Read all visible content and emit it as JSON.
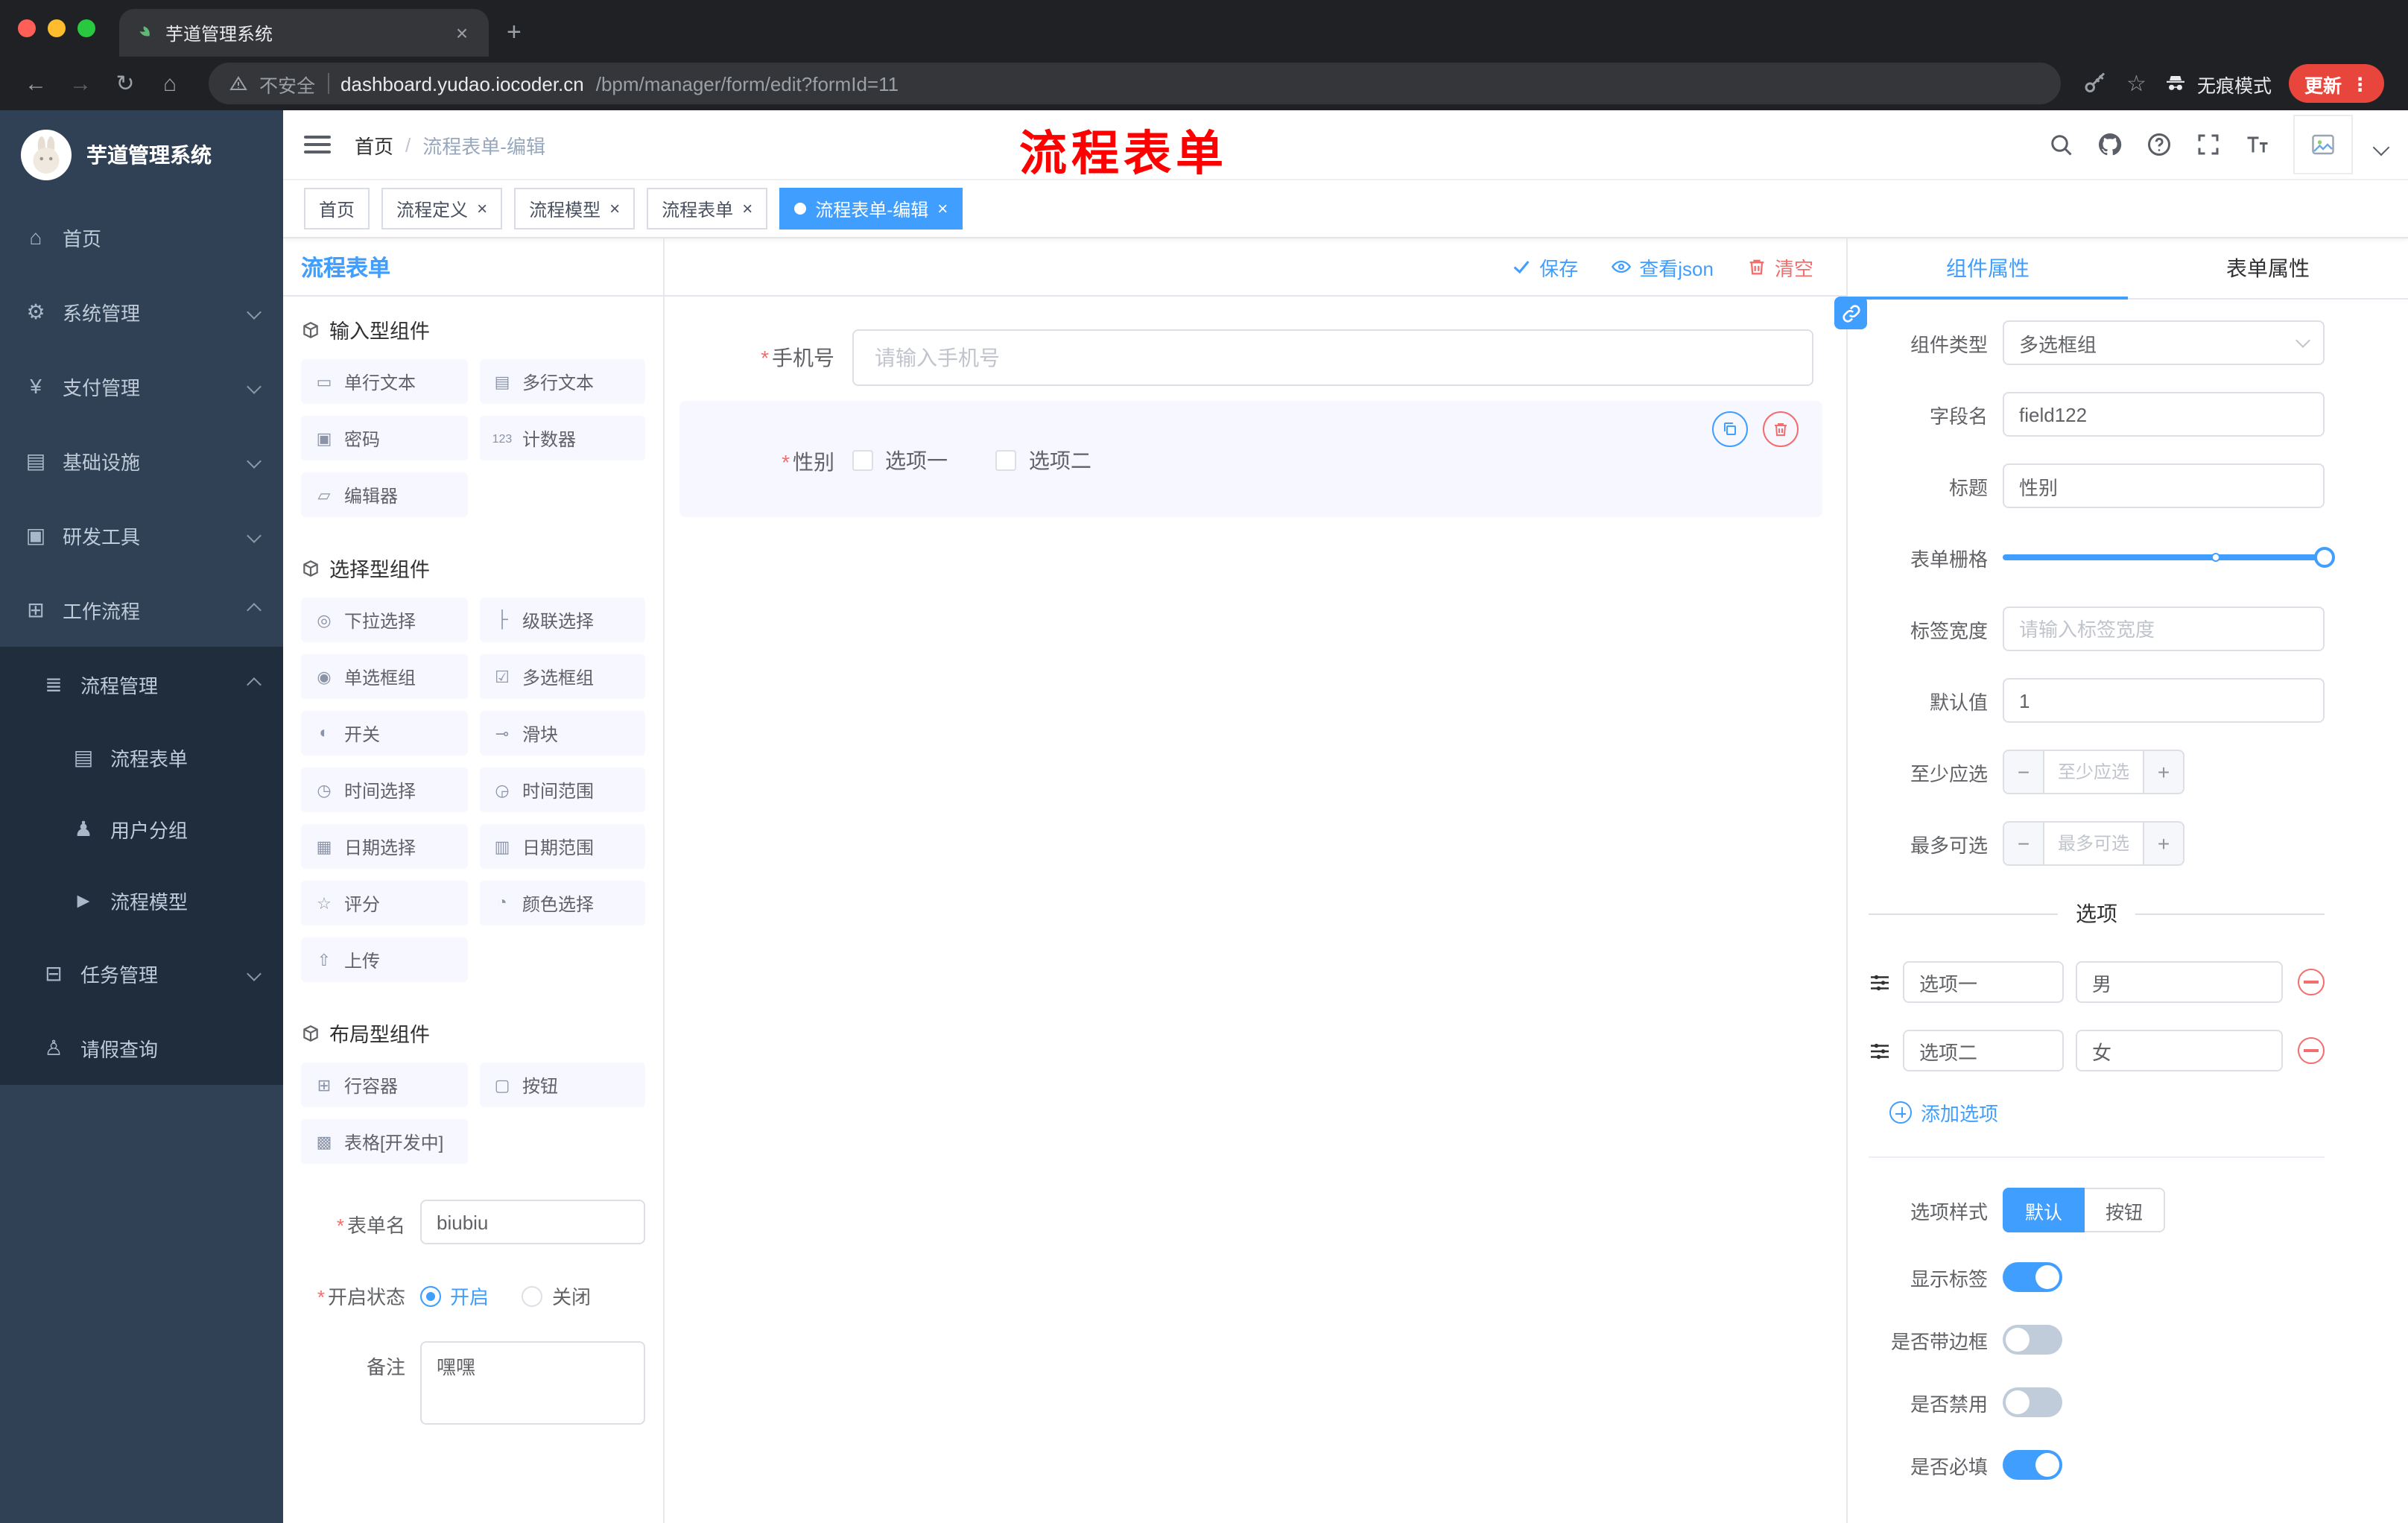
{
  "colors": {
    "accent": "#409eff",
    "danger": "#f56c6c",
    "annotation_red": "#ff0000",
    "sidebar_bg": "#304156",
    "sidebar_submenu_bg": "#1f2d3d",
    "chrome_bg": "#202124",
    "chrome_surface": "#35363a",
    "update_pill": "#e8453c"
  },
  "glyphs": {
    "close": "×",
    "plus": "+",
    "minus": "−",
    "kebab": "⋮",
    "star": "☆",
    "back": "←",
    "forward": "→",
    "reload": "↻",
    "home": "⌂",
    "newtab": "+",
    "req": "*"
  },
  "browser": {
    "tab_title": "芋道管理系统",
    "security_label": "不安全",
    "url_domain": "dashboard.yudao.iocoder.cn",
    "url_path": "/bpm/manager/form/edit?formId=11",
    "incognito_label": "无痕模式",
    "update_label": "更新"
  },
  "sidebar": {
    "logo_title": "芋道管理系统",
    "items": [
      {
        "glyph": "⌂",
        "label": "首页"
      },
      {
        "glyph": "⚙",
        "label": "系统管理"
      },
      {
        "glyph": "¥",
        "label": "支付管理"
      },
      {
        "glyph": "▤",
        "label": "基础设施"
      },
      {
        "glyph": "▣",
        "label": "研发工具"
      },
      {
        "glyph": "⊞",
        "label": "工作流程"
      }
    ],
    "process_mgmt": {
      "glyph": "≣",
      "label": "流程管理"
    },
    "process_children": [
      {
        "glyph": "▤",
        "label": "流程表单"
      },
      {
        "glyph": "♟",
        "label": "用户分组"
      },
      {
        "glyph": "►",
        "label": "流程模型"
      }
    ],
    "task_mgmt": {
      "glyph": "⊟",
      "label": "任务管理"
    },
    "leave_query": {
      "glyph": "♙",
      "label": "请假查询"
    }
  },
  "header": {
    "breadcrumb": {
      "home": "首页",
      "sep": "/",
      "current": "流程表单-编辑"
    },
    "annotation": "流程表单"
  },
  "tags": {
    "items": [
      {
        "label": "首页",
        "closable": false,
        "active": false
      },
      {
        "label": "流程定义",
        "closable": true,
        "active": false
      },
      {
        "label": "流程模型",
        "closable": true,
        "active": false
      },
      {
        "label": "流程表单",
        "closable": true,
        "active": false
      },
      {
        "label": "流程表单-编辑",
        "closable": true,
        "active": true
      }
    ]
  },
  "designer": {
    "title": "流程表单",
    "actions": {
      "save": "保存",
      "view_json": "查看json",
      "clear": "清空"
    },
    "palette": {
      "groups": [
        {
          "title": "输入型组件",
          "items": [
            {
              "glyph": "▭",
              "label": "单行文本"
            },
            {
              "glyph": "▤",
              "label": "多行文本"
            },
            {
              "glyph": "▣",
              "label": "密码"
            },
            {
              "glyph": "123",
              "label": "计数器"
            },
            {
              "glyph": "▱",
              "label": "编辑器"
            }
          ]
        },
        {
          "title": "选择型组件",
          "items": [
            {
              "glyph": "◎",
              "label": "下拉选择"
            },
            {
              "glyph": "├",
              "label": "级联选择"
            },
            {
              "glyph": "◉",
              "label": "单选框组"
            },
            {
              "glyph": "☑",
              "label": "多选框组"
            },
            {
              "glyph": "◐",
              "label": "开关"
            },
            {
              "glyph": "⊸",
              "label": "滑块"
            },
            {
              "glyph": "◷",
              "label": "时间选择"
            },
            {
              "glyph": "◶",
              "label": "时间范围"
            },
            {
              "glyph": "▦",
              "label": "日期选择"
            },
            {
              "glyph": "▥",
              "label": "日期范围"
            },
            {
              "glyph": "☆",
              "label": "评分"
            },
            {
              "glyph": "◔",
              "label": "颜色选择"
            },
            {
              "glyph": "⇧",
              "label": "上传"
            }
          ]
        },
        {
          "title": "布局型组件",
          "items": [
            {
              "glyph": "⊞",
              "label": "行容器"
            },
            {
              "glyph": "▢",
              "label": "按钮"
            },
            {
              "glyph": "▩",
              "label": "表格[开发中]"
            }
          ]
        }
      ]
    },
    "meta": {
      "name_label": "表单名",
      "name_value": "biubiu",
      "status_label": "开启状态",
      "status_on": "开启",
      "status_off": "关闭",
      "remark_label": "备注",
      "remark_value": "嘿嘿"
    },
    "canvas": {
      "phone_label": "手机号",
      "phone_placeholder": "请输入手机号",
      "gender_label": "性别",
      "gender_options": [
        "选项一",
        "选项二"
      ]
    }
  },
  "props": {
    "tab_component": "组件属性",
    "tab_form": "表单属性",
    "rows": {
      "type_label": "组件类型",
      "type_value": "多选框组",
      "field_label": "字段名",
      "field_value": "field122",
      "title_label": "标题",
      "title_value": "性别",
      "grid_label": "表单栅格",
      "label_width_label": "标签宽度",
      "label_width_placeholder": "请输入标签宽度",
      "default_label": "默认值",
      "default_value": "1",
      "min_label": "至少应选",
      "min_placeholder": "至少应选",
      "max_label": "最多可选",
      "max_placeholder": "最多可选"
    },
    "options_title": "选项",
    "options": [
      {
        "label": "选项一",
        "value": "男"
      },
      {
        "label": "选项二",
        "value": "女"
      }
    ],
    "add_option": "添加选项",
    "style_label": "选项样式",
    "style_default": "默认",
    "style_button": "按钮",
    "switch_rows": [
      {
        "label": "显示标签",
        "on": true
      },
      {
        "label": "是否带边框",
        "on": false
      },
      {
        "label": "是否禁用",
        "on": false
      },
      {
        "label": "是否必填",
        "on": true
      }
    ]
  }
}
